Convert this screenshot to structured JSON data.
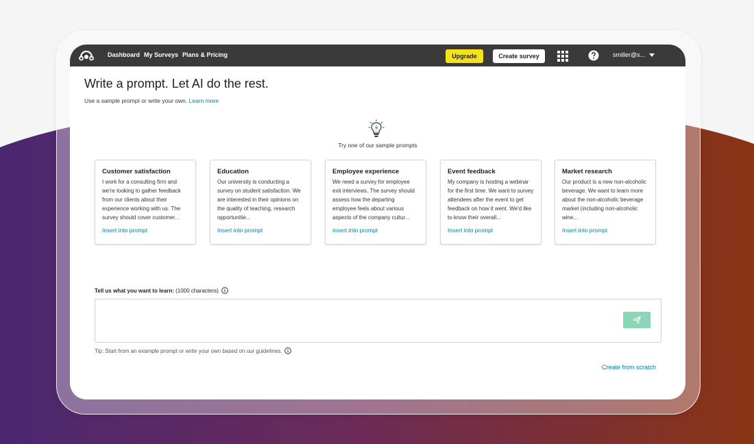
{
  "nav": {
    "links": [
      "Dashboard",
      "My Surveys",
      "Plans & Pricing"
    ],
    "upgrade_label": "Upgrade",
    "create_label": "Create survey",
    "user_label": "smiller@s..."
  },
  "page": {
    "title": "Write a prompt. Let AI do the rest.",
    "subtitle": "Use a sample prompt or write your own.",
    "learn_more": "Learn more",
    "samples_caption": "Try one of our sample prompts"
  },
  "cards": [
    {
      "title": "Customer satisfaction",
      "body": "I work for a consulting firm and we're looking to gather feedback from our clients about their experience working with us. The survey should cover customer...",
      "link": "Insert into prompt"
    },
    {
      "title": "Education",
      "body": "Our university is conducting a survey on student satisfaction. We are interested in their opinions on the quality of teaching, research opportunitie...",
      "link": "Insert into prompt"
    },
    {
      "title": "Employee experience",
      "body": "We need a survey for employee exit interviews. The survey should assess how the departing employee feels about various aspects of the company cultur...",
      "link": "Insert into prompt"
    },
    {
      "title": "Event feedback",
      "body": "My company is hosting a webinar for the first time. We want to survey attendees after the event to get feedback on how it went. We'd like to know their overall...",
      "link": "Insert into prompt"
    },
    {
      "title": "Market research",
      "body": "Our product is a new non-alcoholic beverage. We want to learn more about the non-alcoholic beverage market (including non-alcoholic wine...",
      "link": "Insert into prompt"
    }
  ],
  "prompt": {
    "label_bold": "Tell us what you want to learn:",
    "label_count": "(1000 characters)",
    "value": "",
    "tip": "Tip: Start from an example prompt or write your own based on our guidelines.",
    "scratch_link": "Create from scratch"
  },
  "colors": {
    "navbar": "#3a3a3a",
    "upgrade": "#f5e21a",
    "link": "#007faa",
    "send_button": "#8cd6b8"
  }
}
